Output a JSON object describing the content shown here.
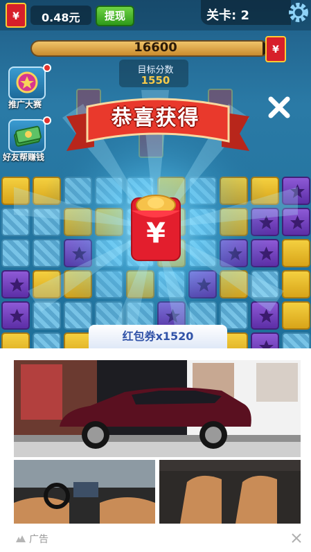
{
  "hud": {
    "balance": "0.48元",
    "withdraw_label": "提现",
    "level_label": "关卡: 2"
  },
  "score": {
    "current": "16600",
    "target_label": "目标分数",
    "target_value": "1550",
    "progress_fraction": 0.98
  },
  "side_menu": [
    {
      "label": "推广大赛",
      "icon": "trophy-medal-icon"
    },
    {
      "label": "好友帮赚钱",
      "icon": "cash-stack-icon"
    }
  ],
  "reward_popup": {
    "title": "恭喜获得",
    "currency_symbol": "¥",
    "voucher_text": "红包券x1520"
  },
  "board": {
    "rows": [
      [
        "y",
        "y",
        "b",
        "b",
        "b",
        "y",
        "b",
        "y",
        "y",
        "p"
      ],
      [
        "b",
        "b",
        "y",
        "y",
        "b",
        "y",
        "b",
        "y",
        "p",
        "p"
      ],
      [
        "b",
        "b",
        "p",
        "b",
        "b",
        "y",
        "b",
        "p",
        "p",
        "y"
      ],
      [
        "p",
        "y",
        "y",
        "b",
        "y",
        "b",
        "p",
        "y",
        "b",
        "y"
      ],
      [
        "p",
        "b",
        "b",
        "b",
        "b",
        "p",
        "b",
        "b",
        "p",
        "y"
      ],
      [
        "y",
        "b",
        "y",
        "b",
        "b",
        "b",
        "b",
        "y",
        "p",
        "b"
      ]
    ]
  },
  "ad": {
    "label": "广告"
  },
  "colors": {
    "brand_red": "#d71f2a",
    "gold": "#f5c94a",
    "voucher_text": "#3153a8"
  }
}
